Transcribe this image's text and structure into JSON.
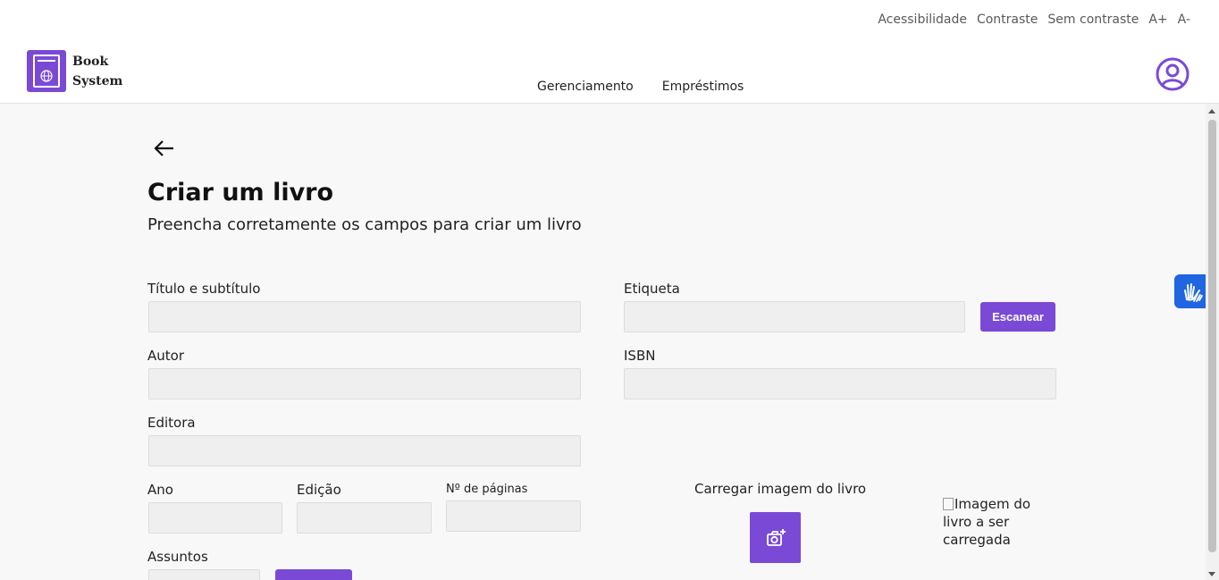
{
  "accessibility": {
    "items": [
      "Acessibilidade",
      "Contraste",
      "Sem contraste",
      "A+",
      "A-"
    ]
  },
  "logo": {
    "line1": "Book",
    "line2": "System"
  },
  "nav": {
    "items": [
      "Gerenciamento",
      "Empréstimos"
    ]
  },
  "page": {
    "title": "Criar um livro",
    "subtitle": "Preencha corretamente os campos para criar um livro"
  },
  "form": {
    "title_label": "Título e subtítulo",
    "title_value": "",
    "tag_label": "Etiqueta",
    "tag_value": "",
    "scan_button": "Escanear",
    "author_label": "Autor",
    "author_value": "",
    "isbn_label": "ISBN",
    "isbn_value": "",
    "publisher_label": "Editora",
    "publisher_value": "",
    "year_label": "Ano",
    "year_value": "",
    "edition_label": "Edição",
    "edition_value": "",
    "pages_label": "Nº de páginas",
    "pages_value": "",
    "subjects_label": "Assuntos",
    "subjects_value": "",
    "upload_label": "Carregar imagem do livro",
    "image_alt": "Imagem do livro a ser carregada"
  },
  "colors": {
    "accent": "#7a4ad6",
    "vlibras": "#1f66e0",
    "field_bg": "#efefef",
    "page_bg": "#f8f8f8"
  },
  "icons": {
    "back": "arrow-left-icon",
    "user": "user-circle-icon",
    "upload": "camera-plus-icon",
    "vlibras": "hands-icon",
    "logo": "book-globe-icon"
  }
}
